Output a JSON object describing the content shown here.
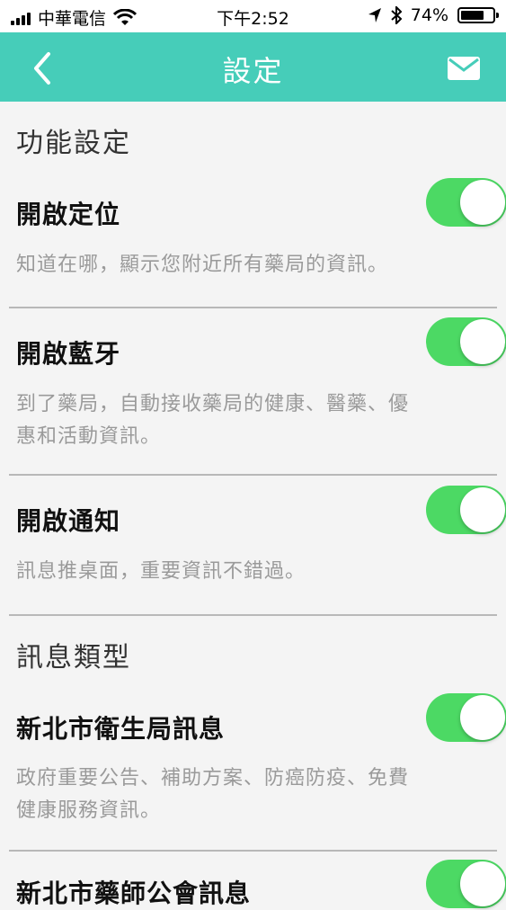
{
  "status_bar": {
    "carrier": "中華電信",
    "time": "下午2:52",
    "battery": "74%",
    "battery_level": 0.74
  },
  "nav": {
    "title": "設定",
    "back_icon": "chevron-left-icon",
    "mail_icon": "envelope-icon"
  },
  "colors": {
    "nav_bg": "#46cdb9",
    "toggle_on": "#4cd964"
  },
  "sections": [
    {
      "header": "功能設定",
      "items": [
        {
          "title": "開啟定位",
          "desc": "知道在哪，顯示您附近所有藥局的資訊。",
          "enabled": true
        },
        {
          "title": "開啟藍牙",
          "desc_lines": [
            "到了藥局，自動接收藥局的健康、醫藥、優",
            "惠和活動資訊。"
          ],
          "enabled": true
        },
        {
          "title": "開啟通知",
          "desc": "訊息推桌面，重要資訊不錯過。",
          "enabled": true
        }
      ]
    },
    {
      "header": "訊息類型",
      "items": [
        {
          "title": "新北市衛生局訊息",
          "desc_lines": [
            "政府重要公告、補助方案、防癌防疫、免費",
            "健康服務資訊。"
          ],
          "enabled": true
        },
        {
          "title": "新北市藥師公會訊息",
          "enabled": true
        }
      ]
    }
  ]
}
